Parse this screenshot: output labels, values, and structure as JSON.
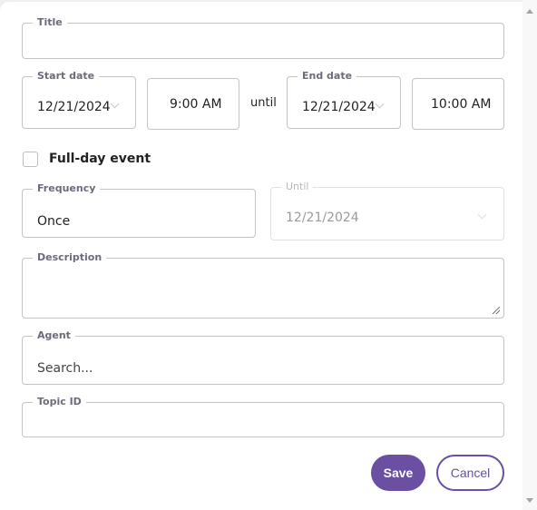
{
  "form": {
    "title": {
      "label": "Title",
      "value": ""
    },
    "start_date": {
      "label": "Start date",
      "value": "12/21/2024"
    },
    "start_time": {
      "value": "9:00 AM"
    },
    "until_connector": "until",
    "end_date": {
      "label": "End date",
      "value": "12/21/2024"
    },
    "end_time": {
      "value": "10:00 AM"
    },
    "full_day": {
      "label": "Full-day event",
      "checked": false
    },
    "frequency": {
      "label": "Frequency",
      "value": "Once"
    },
    "repeat_until": {
      "label": "Until",
      "value": "12/21/2024",
      "disabled": true
    },
    "description": {
      "label": "Description",
      "value": ""
    },
    "agent": {
      "label": "Agent",
      "placeholder": "Search..."
    },
    "topic_id": {
      "label": "Topic ID",
      "value": ""
    }
  },
  "actions": {
    "save_label": "Save",
    "cancel_label": "Cancel"
  },
  "colors": {
    "accent": "#6a4fa3",
    "border": "#c4c4c4",
    "label": "#6b6b7b"
  }
}
